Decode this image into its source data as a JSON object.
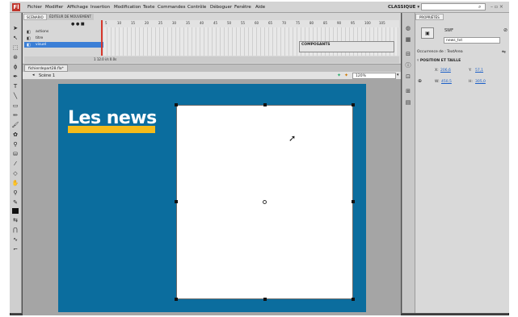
{
  "menu": {
    "app_logo": "Fl",
    "items": [
      "Fichier",
      "Modifier",
      "Affichage",
      "Insertion",
      "Modification",
      "Texte",
      "Commandes",
      "Contrôle",
      "Déboguer",
      "Fenêtre",
      "Aide"
    ],
    "workspace": "CLASSIQUE ▾",
    "search_placeholder": "",
    "window_buttons": "– ▫ ×"
  },
  "timeline": {
    "tab_scenario": "SCÉNARIO",
    "tab_editor": "ÉDITEUR DE MOUVEMENT",
    "layers": [
      {
        "name": "actions"
      },
      {
        "name": "titre"
      },
      {
        "name": "visuel"
      }
    ],
    "ruler": [
      "5",
      "10",
      "15",
      "20",
      "25",
      "30",
      "35",
      "40",
      "45",
      "50",
      "55",
      "60",
      "65",
      "70",
      "75",
      "80",
      "85",
      "90",
      "95",
      "100",
      "105"
    ],
    "components_title": "COMPOSANTS",
    "status": "1   12.0 i/s   0.0s"
  },
  "document": {
    "tab": "fichierdepart28.fla*",
    "scene": "Scène 1",
    "zoom": "120%"
  },
  "stage": {
    "title": "Les news",
    "colors": {
      "stage_bg": "#0b6d9e",
      "accent_bar": "#f4bb1a"
    }
  },
  "properties": {
    "tab": "PROPRIÉTÉS",
    "symbol_type": "SWF",
    "instance_name": "news_txt",
    "instance_of_label": "Occurrence de :",
    "instance_of_value": "TextArea",
    "section": "POSITION ET TAILLE",
    "x_label": "X:",
    "x_value": "206,6",
    "y_label": "Y:",
    "y_value": "57,1",
    "w_label": "W:",
    "w_value": "450,5",
    "h_label": "H:",
    "h_value": "305,0"
  }
}
